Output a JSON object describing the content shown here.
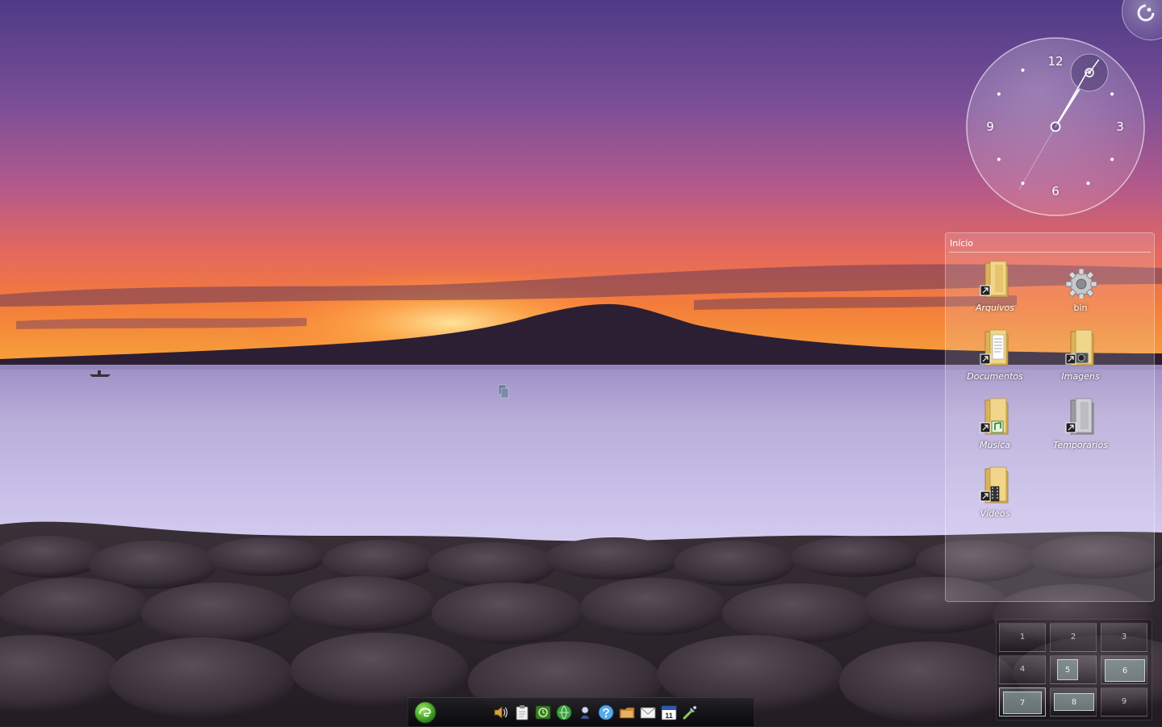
{
  "folder_view": {
    "title": "Início",
    "items": [
      {
        "label": "Arquivos",
        "icon": "folder-shortcut-icon"
      },
      {
        "label": "bin",
        "icon": "gear-icon"
      },
      {
        "label": "Documentos",
        "icon": "folder-documents-icon"
      },
      {
        "label": "Imagens",
        "icon": "folder-images-icon"
      },
      {
        "label": "Musica",
        "icon": "folder-music-icon"
      },
      {
        "label": "Temporarios",
        "icon": "folder-temp-icon"
      },
      {
        "label": "Videos",
        "icon": "folder-videos-icon"
      }
    ]
  },
  "clock": {
    "numerals": [
      "12",
      "3",
      "6",
      "9"
    ],
    "time": {
      "hour": 1,
      "minute": 5,
      "second": 6
    }
  },
  "pager": {
    "desktops": [
      "1",
      "2",
      "3",
      "4",
      "5",
      "6",
      "7",
      "8",
      "9"
    ]
  },
  "taskbar": {
    "launcher_icon": "opensuse-launcher-icon",
    "tray_icons": [
      "volume-icon",
      "clipboard-icon",
      "update-applet-icon",
      "network-icon",
      "bluetooth-icon",
      "chat-icon",
      "file-manager-icon",
      "mail-icon",
      "calendar-icon",
      "tools-icon"
    ],
    "calendar_day": "11"
  },
  "colors": {
    "sky_top": "#5b3f8c",
    "sunset": "#f06a30",
    "water": "#c5bce6",
    "panel_glass": "#ffffff"
  }
}
